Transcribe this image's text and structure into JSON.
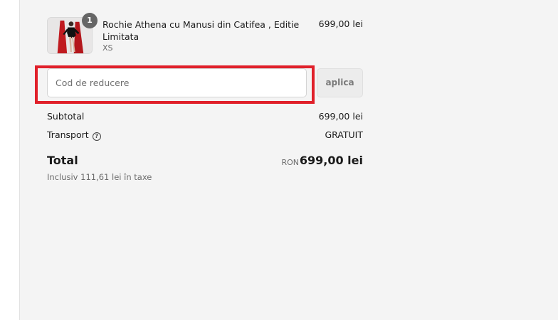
{
  "product": {
    "name": "Rochie Athena cu Manusi din Catifea , Editie Limitata",
    "variant": "XS",
    "price": "699,00 lei",
    "quantity": "1"
  },
  "discount": {
    "placeholder": "Cod de reducere",
    "apply_label": "aplica",
    "highlight_color": "#e0202a"
  },
  "totals": {
    "subtotal_label": "Subtotal",
    "subtotal_value": "699,00 lei",
    "shipping_label": "Transport",
    "shipping_value": "GRATUIT",
    "total_label": "Total",
    "currency": "RON",
    "total_value": "699,00 lei",
    "tax_note": "Inclusiv 111,61 lei în taxe"
  },
  "colors": {
    "summary_background": "#f4f4f4",
    "badge": "#666666"
  }
}
